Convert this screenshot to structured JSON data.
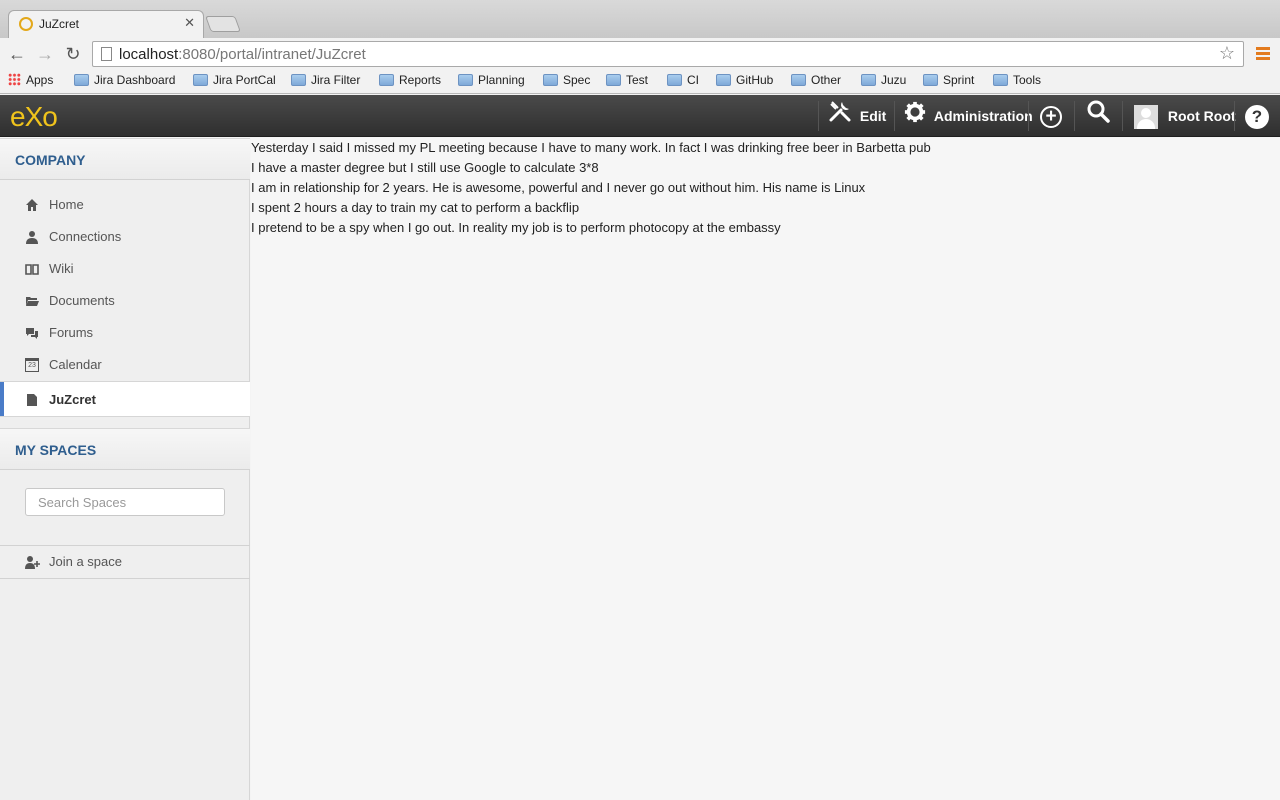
{
  "browser": {
    "tab_title": "JuZcret",
    "url_host": "localhost",
    "url_rest": ":8080/portal/intranet/JuZcret",
    "bookmarks": [
      "Apps",
      "Jira Dashboard",
      "Jira PortCal",
      "Jira Filter",
      "Reports",
      "Planning",
      "Spec",
      "Test",
      "CI",
      "GitHub",
      "Other",
      "Juzu",
      "Sprint",
      "Tools"
    ]
  },
  "topbar": {
    "logo": "eXo",
    "edit_label": "Edit",
    "administration_label": "Administration",
    "user_name": "Root Root",
    "help_label": "?"
  },
  "sidebar": {
    "company_title": "COMPANY",
    "items": [
      {
        "label": "Home",
        "icon": "home-icon"
      },
      {
        "label": "Connections",
        "icon": "user-icon"
      },
      {
        "label": "Wiki",
        "icon": "book-icon"
      },
      {
        "label": "Documents",
        "icon": "folder-icon"
      },
      {
        "label": "Forums",
        "icon": "comments-icon"
      },
      {
        "label": "Calendar",
        "icon": "calendar-icon"
      },
      {
        "label": "JuZcret",
        "icon": "page-icon",
        "active": true
      }
    ],
    "calendar_day": "23",
    "myspaces_title": "MY SPACES",
    "search_placeholder": "Search Spaces",
    "join_label": "Join a space"
  },
  "content": {
    "lines": [
      "Yesterday I said I missed my PL meeting because I have to many work. In fact I was drinking free beer in Barbetta pub",
      "I have a master degree but I still use Google to calculate 3*8",
      "I am in relationship for 2 years. He is awesome, powerful and I never go out without him. His name is Linux",
      "I spent 2 hours a day to train my cat to perform a backflip",
      "I pretend to be a spy when I go out. In reality my job is to perform photocopy at the embassy"
    ]
  },
  "colors": {
    "accent": "#4a7cc8",
    "section_title": "#2f5e8e",
    "logo": "#f0c31c",
    "topbar": "#3a3a3a"
  }
}
